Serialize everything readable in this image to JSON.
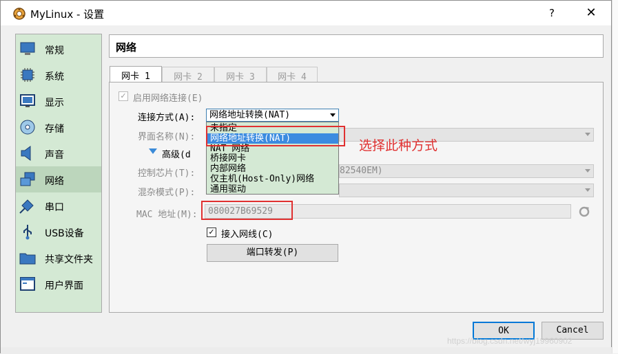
{
  "window": {
    "title": "MyLinux - 设置",
    "help": "?",
    "close": "✕"
  },
  "sidebar": {
    "items": [
      {
        "label": "常规",
        "icon": "monitor-icon"
      },
      {
        "label": "系统",
        "icon": "chip-icon"
      },
      {
        "label": "显示",
        "icon": "display-icon"
      },
      {
        "label": "存储",
        "icon": "disk-icon"
      },
      {
        "label": "声音",
        "icon": "speaker-icon"
      },
      {
        "label": "网络",
        "icon": "network-icon",
        "active": true
      },
      {
        "label": "串口",
        "icon": "serial-icon"
      },
      {
        "label": "USB设备",
        "icon": "usb-icon"
      },
      {
        "label": "共享文件夹",
        "icon": "folder-icon"
      },
      {
        "label": "用户界面",
        "icon": "window-icon"
      }
    ]
  },
  "page": {
    "title": "网络"
  },
  "tabs": [
    {
      "label": "网卡 1",
      "active": true
    },
    {
      "label": "网卡 2"
    },
    {
      "label": "网卡 3"
    },
    {
      "label": "网卡 4"
    }
  ],
  "form": {
    "enable_label": "启用网络连接(E)",
    "conn_label": "连接方式(A):",
    "conn_value": "网络地址转换(NAT)",
    "iface_label": "界面名称(N):",
    "advanced_label": "高级(d",
    "chip_label": "控制芯片(T):",
    "chip_value_tail": "82540EM)",
    "promisc_label": "混杂模式(P):",
    "mac_label": "MAC 地址(M):",
    "mac_value": "080027B69529",
    "cable_label": "接入网线(C)",
    "port_forward": "端口转发(P)"
  },
  "dropdown": {
    "options": [
      "未指定",
      "网络地址转换(NAT)",
      "NAT 网络",
      "桥接网卡",
      "内部网络",
      "仅主机(Host-Only)网络",
      "通用驱动"
    ],
    "selected_index": 1
  },
  "annotation": "选择此种方式",
  "buttons": {
    "ok": "OK",
    "cancel": "Cancel"
  },
  "watermark": "https://blog.csdn.net/wyj19960902",
  "colors": {
    "sidebar_bg": "#d4e9d4",
    "selection": "#3b8be0",
    "annotation_red": "#e03030",
    "ok_border": "#0078d7"
  }
}
